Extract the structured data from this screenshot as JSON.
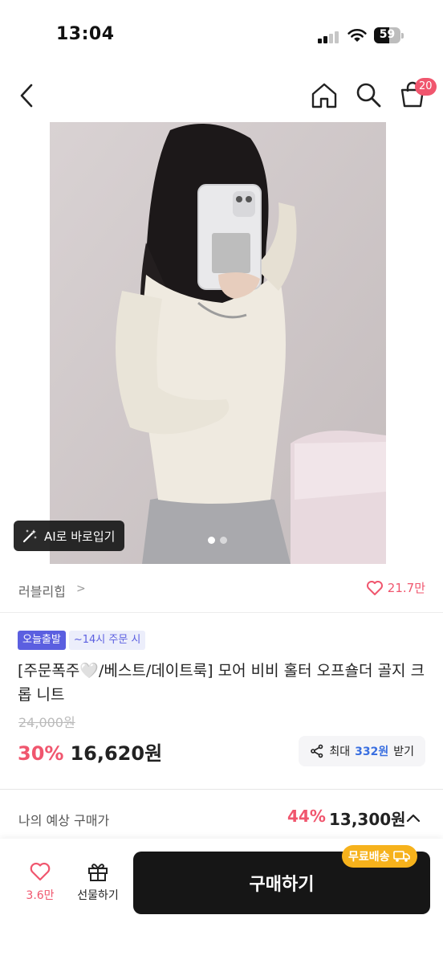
{
  "status_bar": {
    "time": "13:04",
    "battery": "59",
    "battery_level": 0.59
  },
  "header": {
    "cart_count": "20"
  },
  "image": {
    "ai_button_label": "AI로 바로입기",
    "page_count": 2,
    "active_page": 1
  },
  "brand": {
    "name": "러블리힙",
    "chevron": ">",
    "like_count": "21.7만"
  },
  "product": {
    "tags": [
      "오늘출발",
      "~14시 주문 시"
    ],
    "title": "[주문폭주🤍/베스트/데이트룩] 모어 비비 홀터 오프숄더 골지 크롭 니트",
    "original_price": "24,000원",
    "discount": "30%",
    "price": "16,620원",
    "coupon": {
      "prefix": "최대",
      "amount": "332원",
      "suffix": "받기"
    }
  },
  "estimate": {
    "label": "나의 예상 구매가",
    "discount": "44%",
    "price": "13,300원"
  },
  "bottom_bar": {
    "like_count": "3.6만",
    "gift_label": "선물하기",
    "buy_label": "구매하기",
    "free_shipping": "무료배송"
  },
  "colors": {
    "accent": "#f0566e",
    "tag": "#5b5fe0",
    "coupon": "#3a6fe0",
    "buy": "#161616",
    "shipping": "#f6b21c"
  }
}
